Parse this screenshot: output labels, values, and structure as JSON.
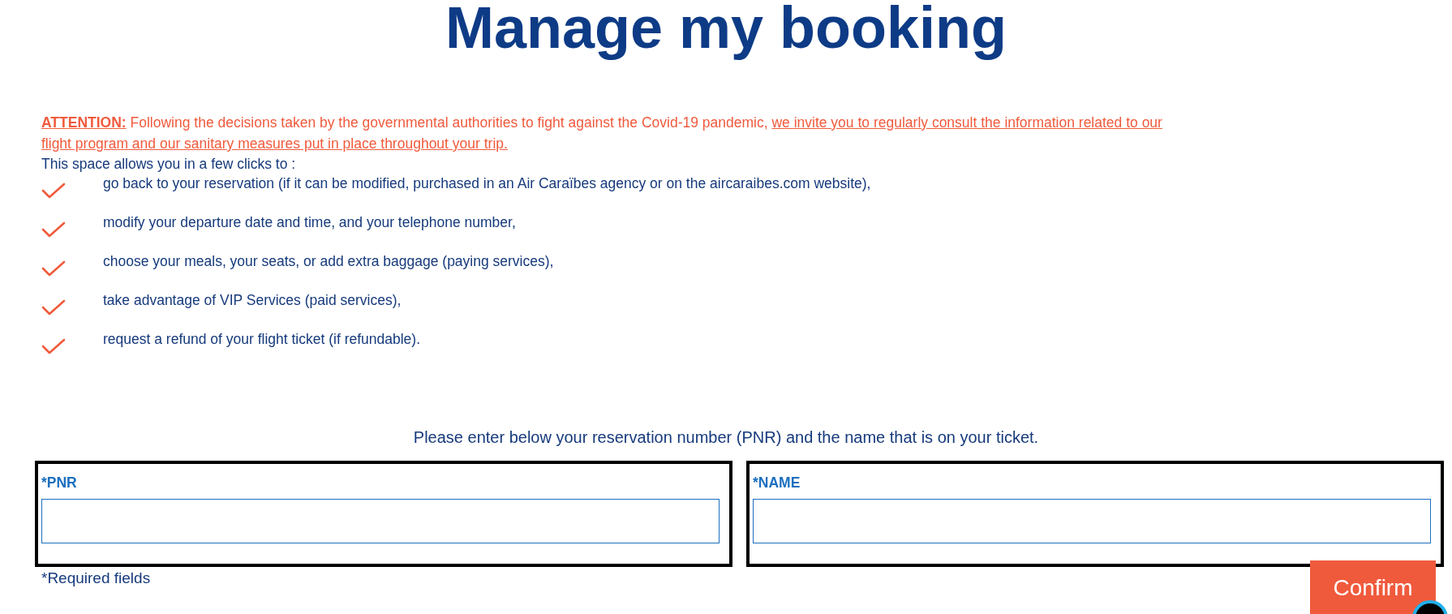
{
  "title": "Manage my booking",
  "attention": {
    "label": "ATTENTION:",
    "text": " Following the decisions taken by the governmental authorities to fight against the Covid-19 pandemic, ",
    "link_lines": [
      "we invite you to regularly consult the information related to our",
      "flight program and our sanitary measures put in place throughout your trip."
    ]
  },
  "intro": "This space allows you in a few clicks to :",
  "features": [
    {
      "text": "go back to your reservation (if it can be modified, purchased in an Air Caraïbes agency or on the aircaraibes.com website),"
    },
    {
      "text": "modify your departure date and time, and your telephone number,"
    },
    {
      "text": "choose your meals, your seats, or add extra baggage (paying services),"
    },
    {
      "text": "take advantage of VIP Services (paid services),"
    },
    {
      "text": "request a refund of your flight ticket (if refundable)."
    }
  ],
  "instruction": "Please enter below your reservation number (PNR) and the name that is on your ticket.",
  "fields": [
    {
      "label": "*PNR"
    },
    {
      "label": "*NAME"
    }
  ],
  "required_note": "*Required fields",
  "confirm_button": "Confirm"
}
